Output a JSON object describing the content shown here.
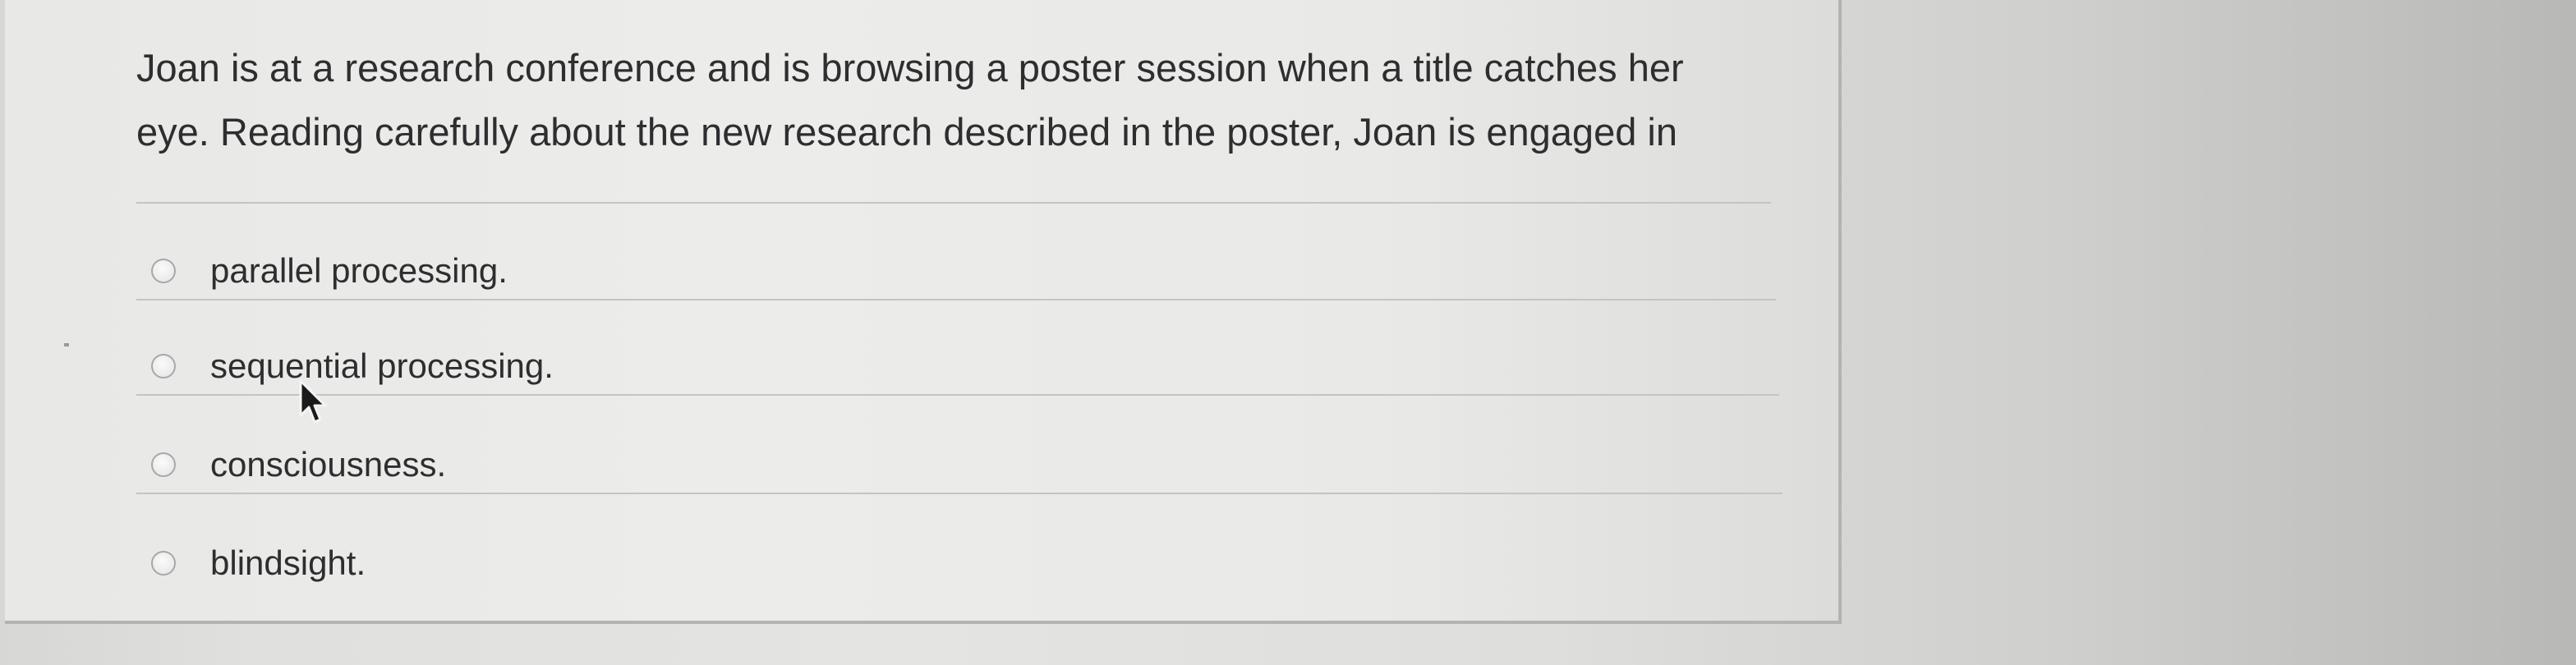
{
  "question": {
    "text": "Joan is at a research conference and is browsing a poster session when a title catches her eye. Reading carefully about the new research described in the poster, Joan is engaged in"
  },
  "options": [
    {
      "label": "parallel processing.",
      "selected": false
    },
    {
      "label": "sequential processing.",
      "selected": false
    },
    {
      "label": "consciousness.",
      "selected": false
    },
    {
      "label": "blindsight.",
      "selected": false
    }
  ],
  "colors": {
    "text": "#2e2e30",
    "panel": "#ebebe9",
    "background": "#dcdcda",
    "divider": "#c4c4c2"
  },
  "icons": {
    "radio": "radio-button-icon",
    "cursor": "mouse-pointer-icon"
  }
}
